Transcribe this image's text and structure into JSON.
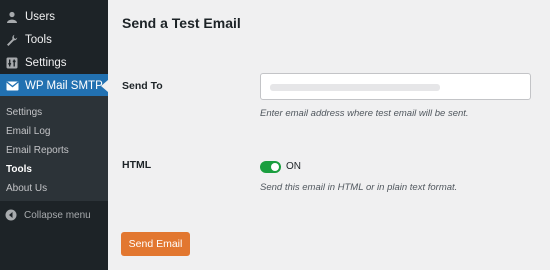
{
  "sidebar": {
    "items": [
      {
        "label": "Users",
        "icon": "user-icon"
      },
      {
        "label": "Tools",
        "icon": "wrench-icon"
      },
      {
        "label": "Settings",
        "icon": "settings-icon"
      },
      {
        "label": "WP Mail SMTP",
        "icon": "wp-mail-smtp-icon"
      }
    ],
    "submenu": [
      {
        "label": "Settings"
      },
      {
        "label": "Email Log"
      },
      {
        "label": "Email Reports"
      },
      {
        "label": "Tools"
      },
      {
        "label": "About Us"
      }
    ],
    "collapse_label": "Collapse menu"
  },
  "main": {
    "title": "Send a Test Email",
    "send_to": {
      "label": "Send To",
      "value": "",
      "description": "Enter email address where test email will be sent."
    },
    "html": {
      "label": "HTML",
      "toggle_state": "ON",
      "description": "Send this email in HTML or in plain text format."
    },
    "send_button_label": "Send Email"
  },
  "colors": {
    "sidebar_bg": "#1d2327",
    "active_menu": "#2271b1",
    "toggle_on": "#1a9e3f",
    "button": "#e27730"
  }
}
